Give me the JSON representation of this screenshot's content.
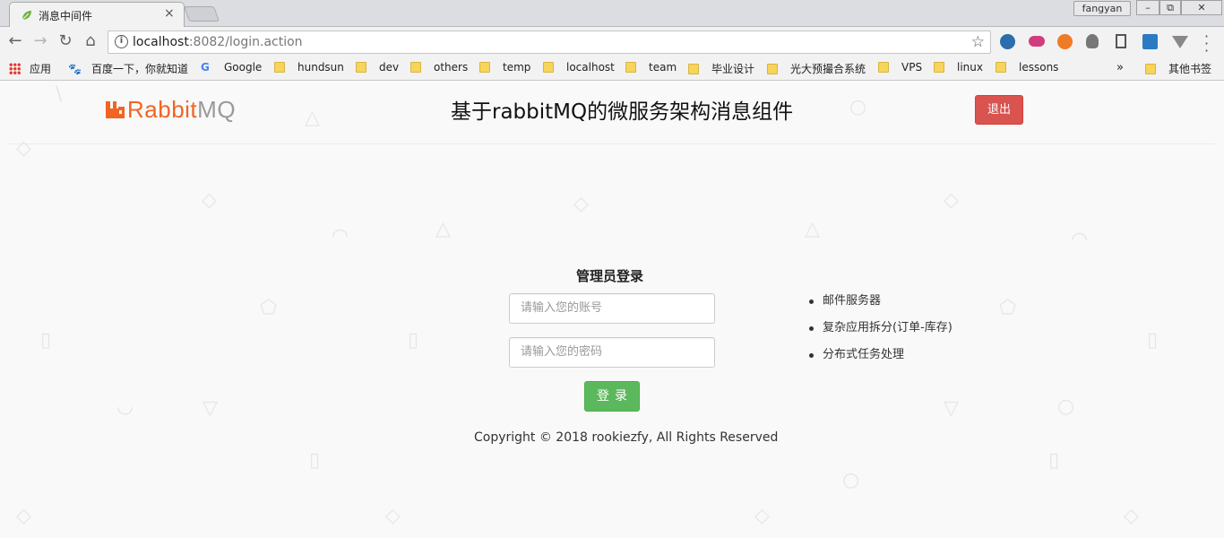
{
  "browser": {
    "tab_title": "消息中间件",
    "tab_close": "×",
    "profile_name": "fangyan",
    "url_host": "localhost",
    "url_path": ":8082/login.action",
    "bookmarks": [
      "应用",
      "百度一下，你就知道",
      "Google",
      "hundsun",
      "dev",
      "others",
      "temp",
      "localhost",
      "team",
      "毕业设计",
      "光大预撮合系统",
      "VPS",
      "linux",
      "lessons"
    ],
    "bookmarks_more": "»",
    "other_bookmarks": "其他书签"
  },
  "header": {
    "logo_main": "Rabbit",
    "logo_suffix": "MQ",
    "title": "基于rabbitMQ的微服务架构消息组件",
    "logout_label": "退出"
  },
  "login": {
    "title": "管理员登录",
    "username_placeholder": "请输入您的账号",
    "password_placeholder": "请输入您的密码",
    "submit_label": "登录"
  },
  "features": [
    "邮件服务器",
    "复杂应用拆分(订单-库存)",
    "分布式任务处理"
  ],
  "footer": {
    "copyright": "Copyright © 2018 rookiezfy, All Rights Reserved"
  },
  "colors": {
    "brand": "#f26422",
    "logout": "#d9534f",
    "submit": "#5cb85c"
  },
  "icons": [
    "spring-leaf-icon",
    "close-icon",
    "back-icon",
    "forward-icon",
    "reload-icon",
    "home-icon",
    "info-icon",
    "star-icon",
    "menu-icon",
    "apps-icon",
    "folder-icon",
    "rabbitmq-logo-icon"
  ]
}
